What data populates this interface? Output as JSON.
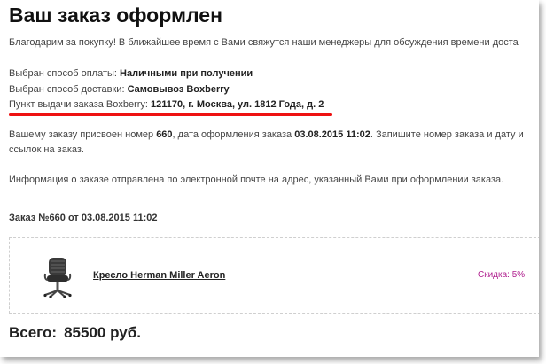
{
  "page": {
    "title": "Ваш заказ оформлен",
    "thanks": "Благодарим за покупку! В ближайшее время с Вами свяжутся наши менеджеры для обсуждения времени доста",
    "payment_label": "Выбран способ оплаты: ",
    "payment_value": "Наличными при получении",
    "delivery_label": "Выбран способ доставки: ",
    "delivery_value": "Самовывоз Boxberry",
    "pickup_label": "Пункт выдачи заказа Boxberry: ",
    "pickup_value": "121170, г. Москва, ул. 1812 Года, д. 2",
    "order_text_1": "Вашему заказу присвоен номер ",
    "order_number": "660",
    "order_text_2": ", дата оформления заказа ",
    "order_date": "03.08.2015 11:02",
    "order_text_3": ". Запишите номер заказа и дату и",
    "order_text_4": "ссылок на заказ.",
    "email_info": "Информация о заказе отправлена по электронной почте на адрес, указанный Вами при оформлении заказа.",
    "order_heading": "Заказ №660 от 03.08.2015 11:02",
    "product_name": "Кресло Herman Miller Aeron",
    "product_icon": "office-chair-image",
    "discount": "Скидка: 5%",
    "total_label": "Всего:",
    "total_value": "85500 руб."
  },
  "colors": {
    "underline_annotation": "#e11111",
    "discount": "#b0208f"
  }
}
